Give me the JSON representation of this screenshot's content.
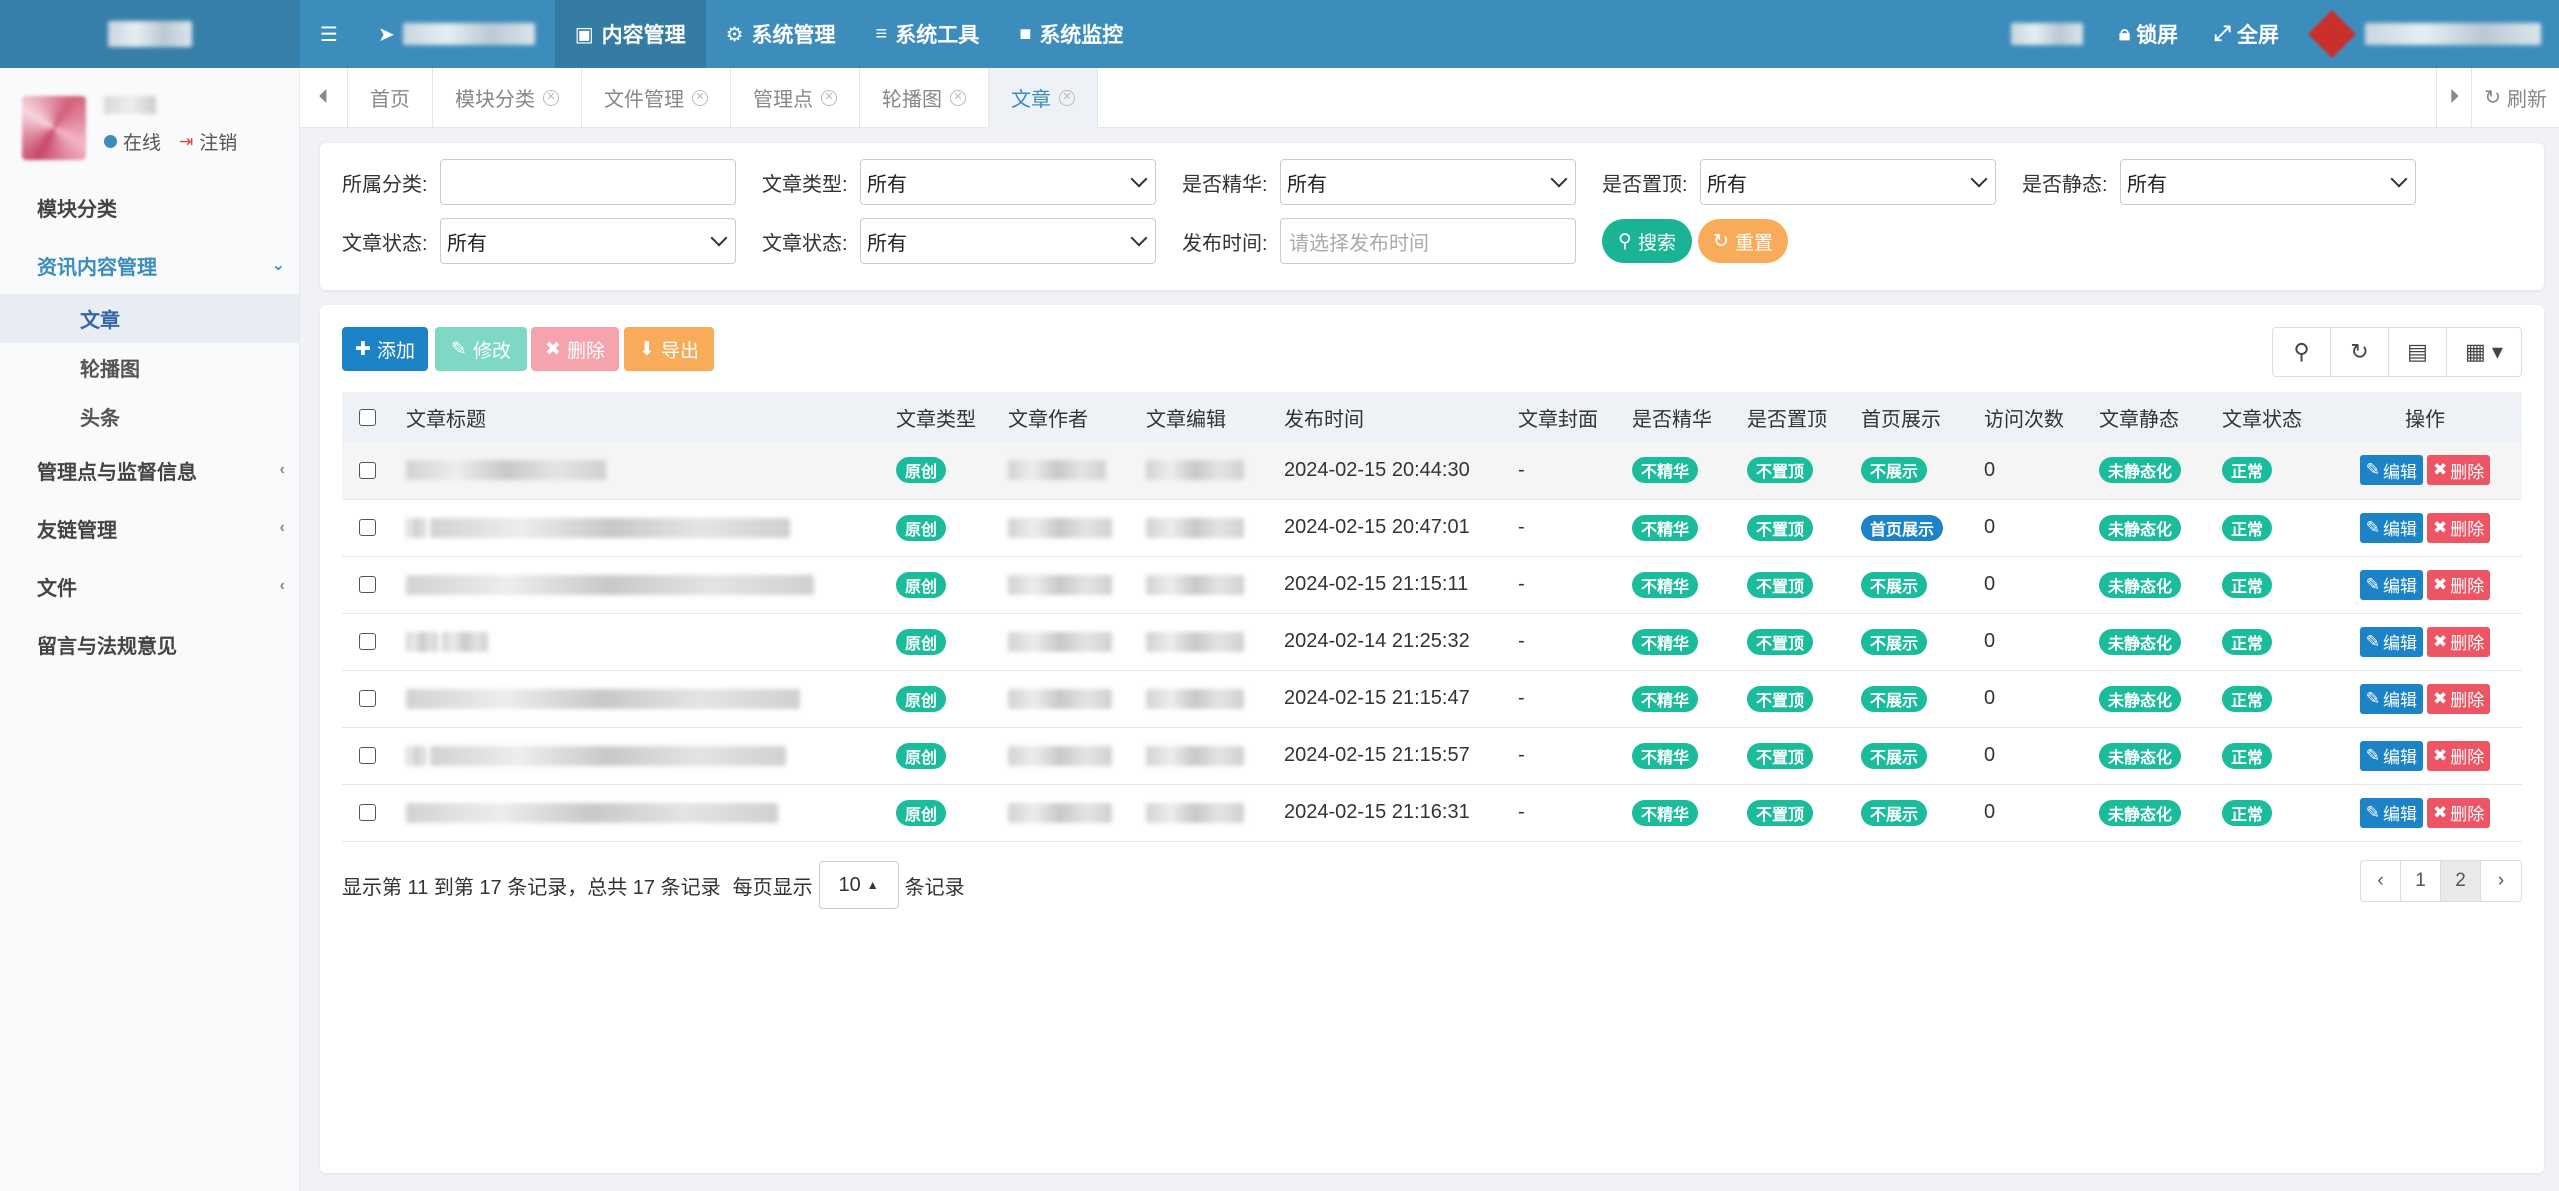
{
  "topnav": {
    "menu_icon": "hamburger-icon",
    "items": [
      {
        "label": "内容管理",
        "icon": "content-icon",
        "active": true
      },
      {
        "label": "系统管理",
        "icon": "gear-icon"
      },
      {
        "label": "系统工具",
        "icon": "list-icon"
      },
      {
        "label": "系统监控",
        "icon": "video-icon"
      }
    ],
    "lock_label": "锁屏",
    "fullscreen_label": "全屏"
  },
  "user": {
    "status": "在线",
    "logout": "注销"
  },
  "sidebar": {
    "items": [
      {
        "label": "模块分类"
      },
      {
        "label": "资讯内容管理",
        "open": true,
        "children": [
          {
            "label": "文章",
            "active": true
          },
          {
            "label": "轮播图"
          },
          {
            "label": "头条"
          }
        ]
      },
      {
        "label": "管理点与监督信息"
      },
      {
        "label": "友链管理"
      },
      {
        "label": "文件"
      },
      {
        "label": "留言与法规意见"
      }
    ]
  },
  "tabs": {
    "items": [
      {
        "label": "首页",
        "closable": false
      },
      {
        "label": "模块分类",
        "closable": true
      },
      {
        "label": "文件管理",
        "closable": true
      },
      {
        "label": "管理点",
        "closable": true
      },
      {
        "label": "轮播图",
        "closable": true
      },
      {
        "label": "文章",
        "closable": true,
        "active": true
      }
    ],
    "refresh": "刷新"
  },
  "filters": {
    "category_label": "所属分类:",
    "category_value": "",
    "type_label": "文章类型:",
    "type_value": "所有",
    "featured_label": "是否精华:",
    "featured_value": "所有",
    "pinned_label": "是否置顶:",
    "pinned_value": "所有",
    "static_label": "是否静态:",
    "static_value": "所有",
    "status1_label": "文章状态:",
    "status1_value": "所有",
    "status2_label": "文章状态:",
    "status2_value": "所有",
    "time_label": "发布时间:",
    "time_placeholder": "请选择发布时间",
    "search_btn": "搜索",
    "reset_btn": "重置"
  },
  "toolbar": {
    "add": "添加",
    "edit": "修改",
    "delete": "删除",
    "export": "导出"
  },
  "table": {
    "columns": [
      "文章标题",
      "文章类型",
      "文章作者",
      "文章编辑",
      "发布时间",
      "文章封面",
      "是否精华",
      "是否置顶",
      "首页展示",
      "访问次数",
      "文章静态",
      "文章状态",
      "操作"
    ],
    "rows": [
      {
        "title": "",
        "type": "原创",
        "author": "",
        "editor": "",
        "time": "2024-02-15 20:44:30",
        "cover": "-",
        "featured": "不精华",
        "pinned": "不置顶",
        "home": "不展示",
        "visits": "0",
        "static": "未静态化",
        "status": "正常"
      },
      {
        "title": "",
        "type": "原创",
        "author": "",
        "editor": "",
        "time": "2024-02-15 20:47:01",
        "cover": "-",
        "featured": "不精华",
        "pinned": "不置顶",
        "home": "首页展示",
        "visits": "0",
        "static": "未静态化",
        "status": "正常"
      },
      {
        "title": "",
        "type": "原创",
        "author": "",
        "editor": "",
        "time": "2024-02-15 21:15:11",
        "cover": "-",
        "featured": "不精华",
        "pinned": "不置顶",
        "home": "不展示",
        "visits": "0",
        "static": "未静态化",
        "status": "正常"
      },
      {
        "title": "",
        "type": "原创",
        "author": "",
        "editor": "",
        "time": "2024-02-14 21:25:32",
        "cover": "-",
        "featured": "不精华",
        "pinned": "不置顶",
        "home": "不展示",
        "visits": "0",
        "static": "未静态化",
        "status": "正常"
      },
      {
        "title": "",
        "type": "原创",
        "author": "",
        "editor": "",
        "time": "2024-02-15 21:15:47",
        "cover": "-",
        "featured": "不精华",
        "pinned": "不置顶",
        "home": "不展示",
        "visits": "0",
        "static": "未静态化",
        "status": "正常"
      },
      {
        "title": "",
        "type": "原创",
        "author": "",
        "editor": "",
        "time": "2024-02-15 21:15:57",
        "cover": "-",
        "featured": "不精华",
        "pinned": "不置顶",
        "home": "不展示",
        "visits": "0",
        "static": "未静态化",
        "status": "正常"
      },
      {
        "title": "",
        "type": "原创",
        "author": "",
        "editor": "",
        "time": "2024-02-15 21:16:31",
        "cover": "-",
        "featured": "不精华",
        "pinned": "不置顶",
        "home": "不展示",
        "visits": "0",
        "static": "未静态化",
        "status": "正常"
      }
    ],
    "edit_label": "编辑",
    "delete_label": "删除"
  },
  "pagination": {
    "info": "显示第 11 到第 17 条记录，总共 17 条记录",
    "per_page_prefix": "每页显示",
    "per_page_value": "10",
    "per_page_suffix": "条记录",
    "prev": "‹",
    "pages": [
      "1",
      "2"
    ],
    "current": "2",
    "next": "›"
  },
  "colors": {
    "primary": "#3c8dbc",
    "success": "#1abc9c",
    "info": "#1c84c6",
    "danger": "#ed5565",
    "warning": "#f8ac59"
  }
}
